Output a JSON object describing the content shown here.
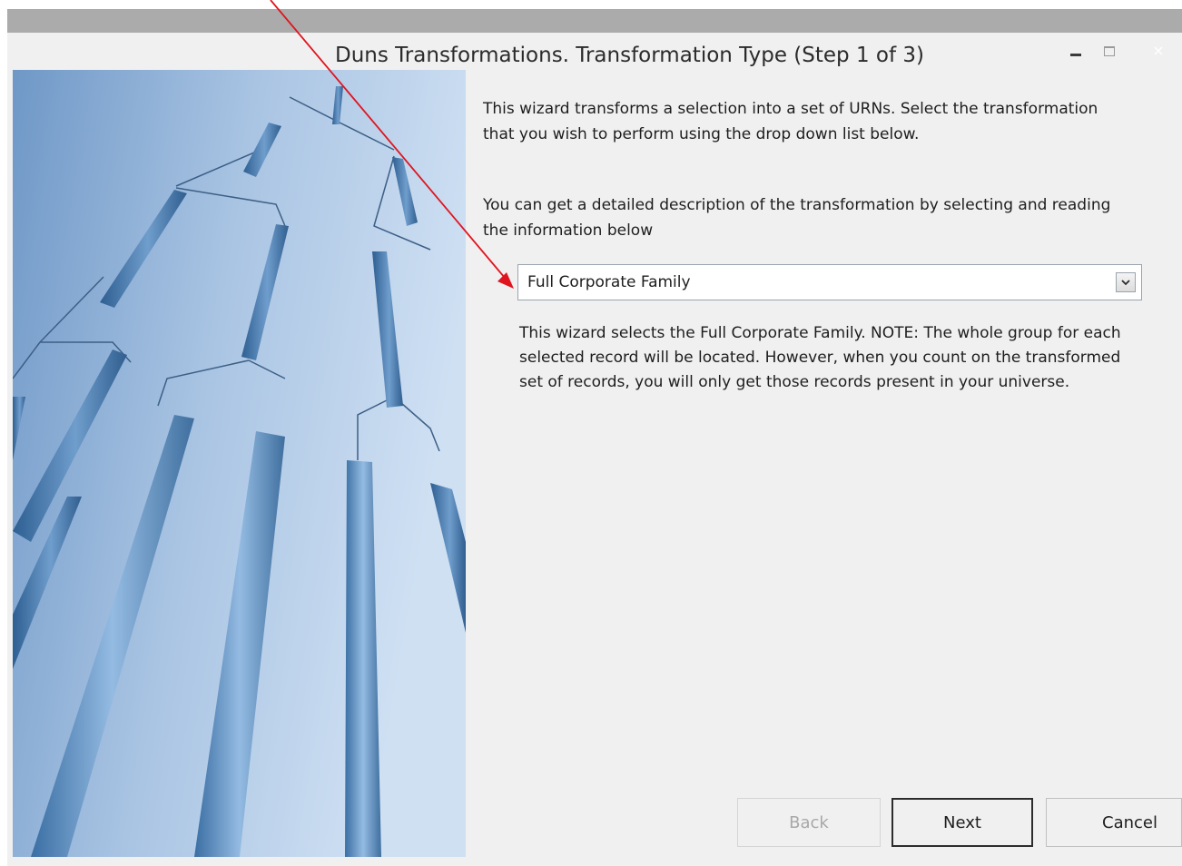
{
  "window": {
    "title": "Duns Transformations.  Transformation Type (Step 1 of 3)",
    "controls": {
      "minimize_icon": "minimize-icon",
      "maximize_icon": "maximize-icon",
      "close_icon": "close-icon",
      "close_glyph": "×"
    }
  },
  "content": {
    "description_1": "This wizard transforms a selection into a set of URNs.  Select the transformation that you wish to perform using the drop down list below.",
    "description_2": "You can get a detailed description of the transformation by selecting and reading the information below",
    "transformation_select": {
      "selected": "Full Corporate Family",
      "arrow_icon": "chevron-down-icon"
    },
    "transformation_info": "This wizard selects the Full Corporate Family.  NOTE: The whole group for each selected record will be located. However, when you count on the transformed set of records, you will only get those records present in your universe."
  },
  "buttons": {
    "back": "Back",
    "next": "Next",
    "cancel": "Cancel"
  },
  "colors": {
    "annotation_arrow": "#e0141e",
    "panel_blue": "#7fa6cf",
    "window_bg": "#f0f0f0"
  }
}
